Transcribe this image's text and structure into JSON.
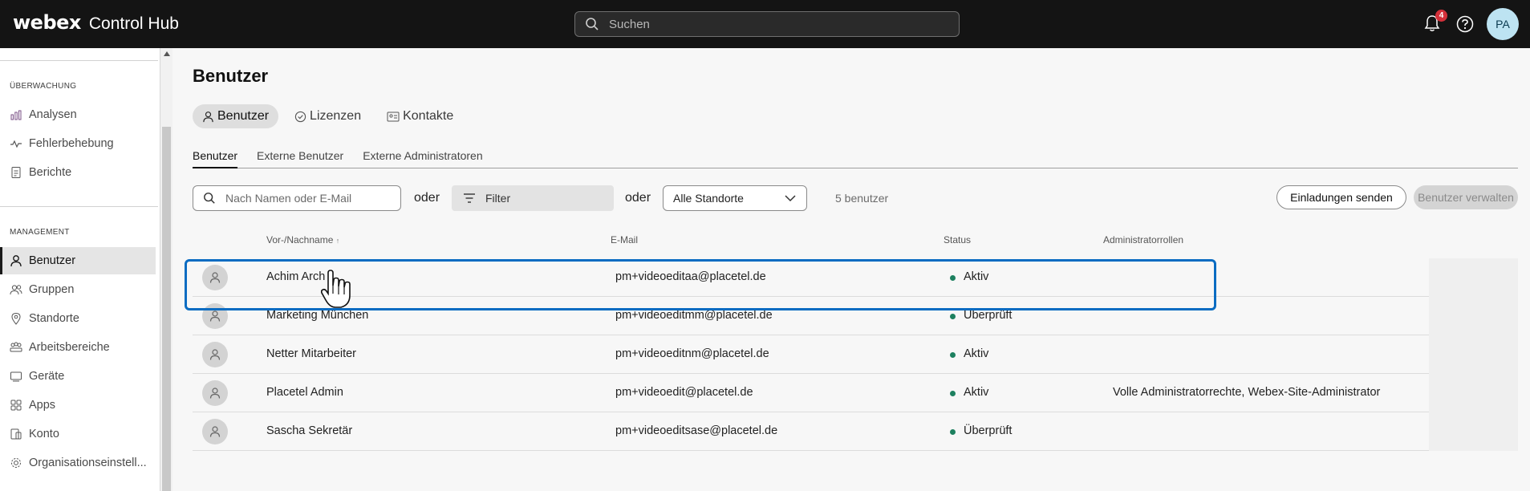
{
  "topbar": {
    "logo": "webex",
    "product": "Control Hub",
    "search_placeholder": "Suchen",
    "notification_count": "4",
    "user_initials": "PA"
  },
  "sidebar": {
    "sections": [
      {
        "title": "ÜBERWACHUNG",
        "items": [
          {
            "label": "Analysen",
            "icon": "bar-chart-icon"
          },
          {
            "label": "Fehlerbehebung",
            "icon": "pulse-icon"
          },
          {
            "label": "Berichte",
            "icon": "report-icon"
          }
        ]
      },
      {
        "title": "MANAGEMENT",
        "items": [
          {
            "label": "Benutzer",
            "icon": "user-icon",
            "active": true
          },
          {
            "label": "Gruppen",
            "icon": "group-icon"
          },
          {
            "label": "Standorte",
            "icon": "location-pin-icon"
          },
          {
            "label": "Arbeitsbereiche",
            "icon": "workspaces-icon"
          },
          {
            "label": "Geräte",
            "icon": "device-icon"
          },
          {
            "label": "Apps",
            "icon": "apps-icon"
          },
          {
            "label": "Konto",
            "icon": "account-icon"
          },
          {
            "label": "Organisationseinstell...",
            "icon": "gear-icon"
          }
        ]
      }
    ]
  },
  "main": {
    "title": "Benutzer",
    "pill_tabs": [
      {
        "label": "Benutzer",
        "icon": "user-icon",
        "active": true
      },
      {
        "label": "Lizenzen",
        "icon": "license-check-icon"
      },
      {
        "label": "Kontakte",
        "icon": "contact-card-icon"
      }
    ],
    "subtabs": [
      {
        "label": "Benutzer",
        "active": true
      },
      {
        "label": "Externe Benutzer"
      },
      {
        "label": "Externe Administratoren"
      }
    ],
    "toolbar": {
      "search_placeholder": "Nach Namen oder E-Mail",
      "or1": "oder",
      "filter_label": "Filter",
      "or2": "oder",
      "location_select": "Alle Standorte",
      "user_count": "5 benutzer",
      "invite_button": "Einladungen senden",
      "manage_button": "Benutzer verwalten"
    },
    "table": {
      "columns": {
        "name": "Vor-/Nachname",
        "email": "E-Mail",
        "status": "Status",
        "roles": "Administratorrollen"
      },
      "rows": [
        {
          "name": "Achim Arch",
          "email": "pm+videoeditaa@placetel.de",
          "status": "Aktiv",
          "roles": ""
        },
        {
          "name": "Marketing München",
          "email": "pm+videoeditmm@placetel.de",
          "status": "Überprüft",
          "roles": ""
        },
        {
          "name": "Netter Mitarbeiter",
          "email": "pm+videoeditnm@placetel.de",
          "status": "Aktiv",
          "roles": ""
        },
        {
          "name": "Placetel Admin",
          "email": "pm+videoedit@placetel.de",
          "status": "Aktiv",
          "roles": "Volle Administratorrechte, Webex-Site-Administrator"
        },
        {
          "name": "Sascha Sekretär",
          "email": "pm+videoeditsase@placetel.de",
          "status": "Überprüft",
          "roles": ""
        }
      ]
    }
  },
  "colors": {
    "topbar": "#141414",
    "status_active": "#1d805f",
    "highlight": "#0b6cc2",
    "badge": "#d4303a"
  }
}
